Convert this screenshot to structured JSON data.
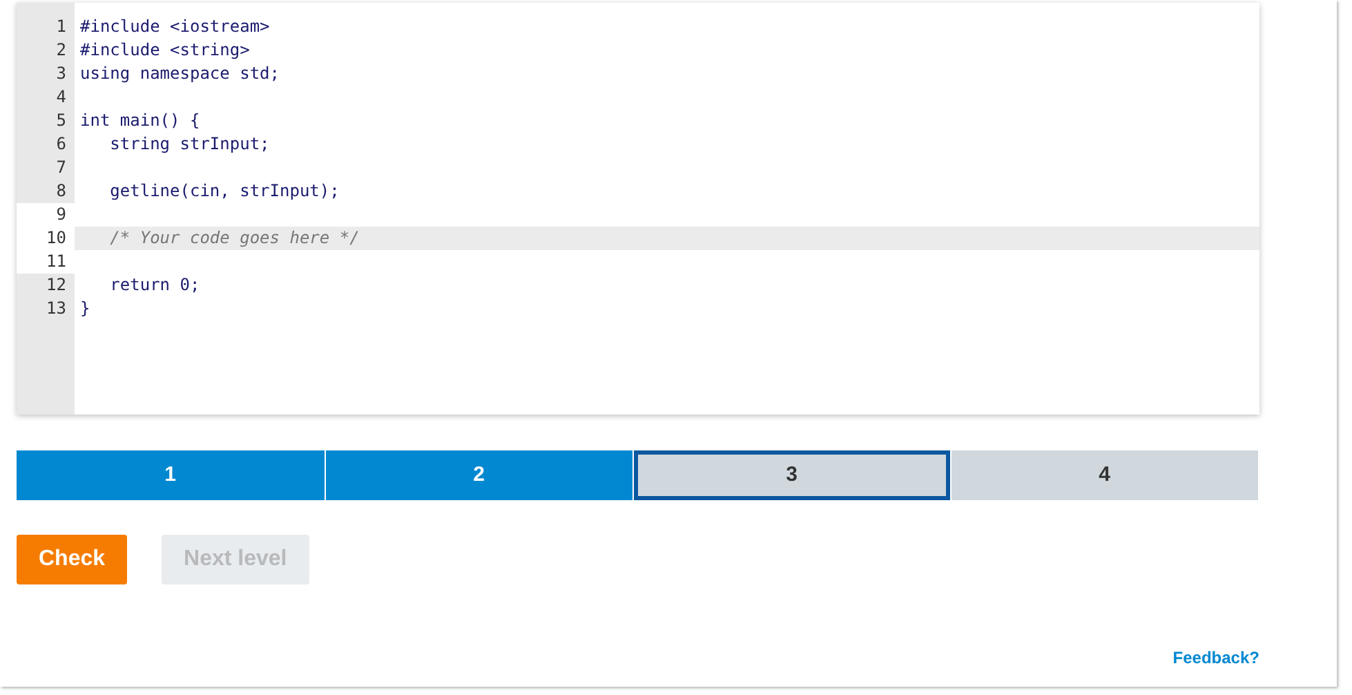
{
  "editor": {
    "lines": [
      {
        "number": "1",
        "text": "#include <iostream>",
        "kind": "code",
        "editable": false,
        "active": false
      },
      {
        "number": "2",
        "text": "#include <string>",
        "kind": "code",
        "editable": false,
        "active": false
      },
      {
        "number": "3",
        "text": "using namespace std;",
        "kind": "code",
        "editable": false,
        "active": false
      },
      {
        "number": "4",
        "kind": "code",
        "editable": false,
        "active": false
      },
      {
        "number": "5",
        "text": "int main() {",
        "kind": "code",
        "editable": false,
        "active": false
      },
      {
        "number": "6",
        "text": "   string strInput;",
        "kind": "code",
        "editable": false,
        "active": false
      },
      {
        "number": "7",
        "kind": "code",
        "editable": false,
        "active": false
      },
      {
        "number": "8",
        "text": "   getline(cin, strInput);",
        "kind": "code",
        "editable": false,
        "active": false
      },
      {
        "number": "9",
        "kind": "code",
        "editable": true,
        "active": false
      },
      {
        "number": "10",
        "text": "   /* Your code goes here */",
        "kind": "comment",
        "editable": true,
        "active": true
      },
      {
        "number": "11",
        "kind": "code",
        "editable": true,
        "active": false
      },
      {
        "number": "12",
        "text": "   return 0;",
        "kind": "code",
        "editable": false,
        "active": false
      },
      {
        "number": "13",
        "text": "}",
        "kind": "code",
        "editable": false,
        "active": false
      }
    ]
  },
  "levels": [
    {
      "label": "1",
      "completed": true,
      "selected": false
    },
    {
      "label": "2",
      "completed": true,
      "selected": false
    },
    {
      "label": "3",
      "completed": false,
      "selected": true
    },
    {
      "label": "4",
      "completed": false,
      "selected": false
    }
  ],
  "buttons": [
    {
      "label": "Check",
      "kind": "primary",
      "disabled": false
    },
    {
      "label": "Next level",
      "kind": "secondary",
      "disabled": true
    }
  ],
  "feedback_link": "Feedback?"
}
